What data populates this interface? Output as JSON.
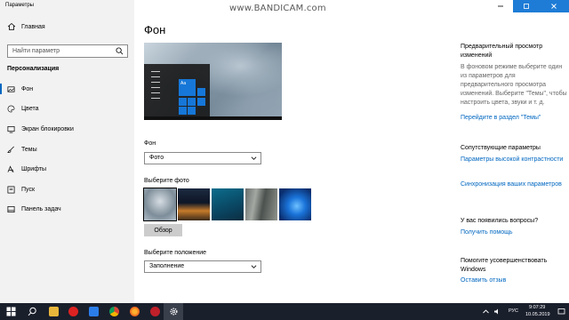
{
  "window": {
    "title": "Параметры",
    "minimize_icon": "minimize-icon",
    "maximize_icon": "maximize-icon",
    "close_icon": "close-icon"
  },
  "watermark": "www.BANDICAM.com",
  "sidebar": {
    "home_label": "Главная",
    "search_placeholder": "Найти параметр",
    "section_title": "Персонализация",
    "items": [
      {
        "label": "Фон",
        "icon": "image-icon",
        "selected": true
      },
      {
        "label": "Цвета",
        "icon": "palette-icon"
      },
      {
        "label": "Экран блокировки",
        "icon": "lockscreen-icon"
      },
      {
        "label": "Темы",
        "icon": "brush-icon"
      },
      {
        "label": "Шрифты",
        "icon": "font-icon"
      },
      {
        "label": "Пуск",
        "icon": "start-icon"
      },
      {
        "label": "Панель задач",
        "icon": "taskbar-icon"
      }
    ]
  },
  "main": {
    "title": "Фон",
    "preview_tile_text": "Aa",
    "background_label": "Фон",
    "background_value": "Фото",
    "choose_photo_label": "Выберите фото",
    "browse_button": "Обзор",
    "fit_label": "Выберите положение",
    "fit_value": "Заполнение"
  },
  "right": {
    "preview_heading": "Предварительный просмотр изменений",
    "preview_text": "В фоновом режиме выберите один из параметров для предварительного просмотра изменений. Выберите \"Темы\", чтобы настроить цвета, звуки и т. д.",
    "themes_link": "Перейдите в раздел \"Темы\"",
    "related_heading": "Сопутствующие параметры",
    "contrast_link": "Параметры высокой контрастности",
    "sync_link": "Синхронизация ваших параметров",
    "question_heading": "У вас появились вопросы?",
    "help_link": "Получить помощь",
    "improve_heading": "Помогите усовершенствовать Windows",
    "feedback_link": "Оставить отзыв"
  },
  "taskbar": {
    "time": "9:07:29",
    "date": "10.05.2019",
    "lang": "РУС"
  },
  "colors": {
    "accent": "#0067c0",
    "sidebar_bg": "#f2f2f2",
    "taskbar_bg": "#1a1f2c"
  }
}
